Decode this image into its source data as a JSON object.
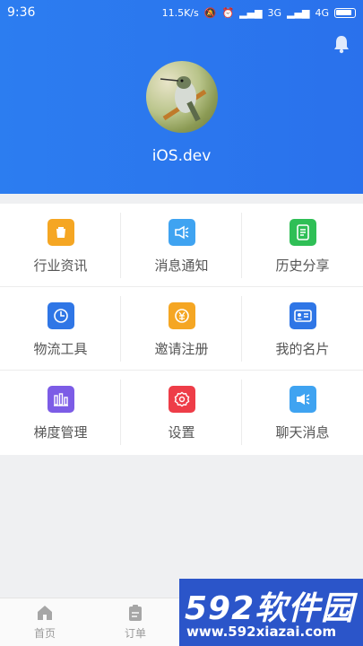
{
  "status_bar": {
    "time": "9:36",
    "net_speed": "11.5K/s",
    "signal_3g": "3G",
    "signal_4g": "4G"
  },
  "profile": {
    "username": "iOS.dev"
  },
  "grid": [
    {
      "label": "行业资讯",
      "icon": "trash-icon",
      "color": "#f5a623"
    },
    {
      "label": "消息通知",
      "icon": "speaker-icon",
      "color": "#3fa3f1"
    },
    {
      "label": "历史分享",
      "icon": "document-icon",
      "color": "#2fbf56"
    },
    {
      "label": "物流工具",
      "icon": "clock-icon",
      "color": "#2f76e6"
    },
    {
      "label": "邀请注册",
      "icon": "refresh-yuan-icon",
      "color": "#f5a623"
    },
    {
      "label": "我的名片",
      "icon": "id-card-icon",
      "color": "#2f76e6"
    },
    {
      "label": "梯度管理",
      "icon": "bar-chart-icon",
      "color": "#7c5ce6"
    },
    {
      "label": "设置",
      "icon": "gear-icon",
      "color": "#ee3d48"
    },
    {
      "label": "聊天消息",
      "icon": "chat-speaker-icon",
      "color": "#3fa3f1"
    }
  ],
  "tabbar": {
    "home": "首页",
    "orders": "订单"
  },
  "watermark": {
    "brand": "592软件园",
    "url": "www.592xiazai.com"
  }
}
